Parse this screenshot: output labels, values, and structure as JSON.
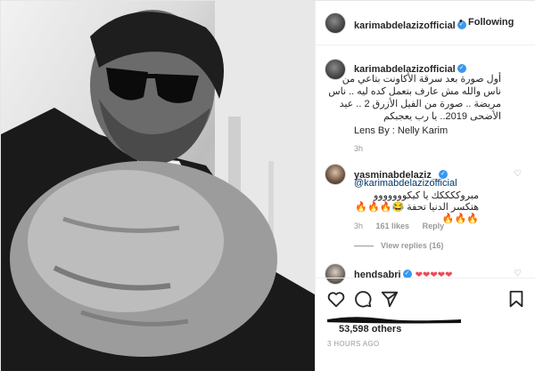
{
  "post": {
    "username": "karimabdelazizofficial",
    "follow_status": "Following",
    "separator": "•"
  },
  "caption": {
    "username": "karimabdelazizofficial",
    "text": "أول صورة بعد سرقة الأكاونت بتاعي من ناس والله مش عارف بتعمل كده ليه .. ناس مريضة .. صورة من الفيل الأزرق 2 .. عيد الأضحى 2019.. يا رب يعجبكم",
    "credit": "Lens By : Nelly Karim",
    "time": "3h"
  },
  "comments": [
    {
      "username": "yasminabdelaziz_",
      "mention": "@karimabdelazizofficial",
      "text": "مبروككككك يا كيكووووووو هتكسر الدنيا تحفة 😂🔥🔥🔥🔥🔥🔥",
      "time": "3h",
      "likes": "161 likes",
      "reply": "Reply",
      "view_replies": "View replies (16)"
    },
    {
      "username": "hendsabri",
      "text": "❤❤❤❤❤"
    }
  ],
  "footer": {
    "likes": "53,598 others",
    "timestamp": "3 HOURS AGO"
  },
  "icons": {
    "verified": "verified-badge-icon",
    "like": "heart-icon",
    "comment": "comment-bubble-icon",
    "share": "paper-plane-icon",
    "save": "bookmark-icon",
    "comment_like": "small-heart-icon"
  },
  "colors": {
    "link": "#003569",
    "verified": "#3897f0",
    "muted": "#999999",
    "heart": "#ed4956"
  }
}
